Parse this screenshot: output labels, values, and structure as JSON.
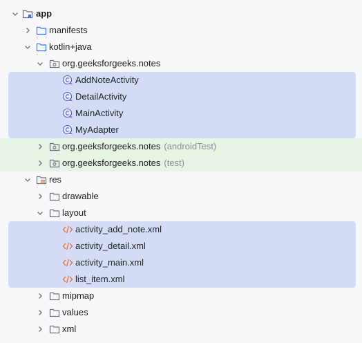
{
  "tree": {
    "app": "app",
    "manifests": "manifests",
    "kotlin_java": "kotlin+java",
    "package_main": "org.geeksforgeeks.notes",
    "classes": [
      "AddNoteActivity",
      "DetailActivity",
      "MainActivity",
      "MyAdapter"
    ],
    "package_android_test": "org.geeksforgeeks.notes",
    "android_test_suffix": "(androidTest)",
    "package_test": "org.geeksforgeeks.notes",
    "test_suffix": "(test)",
    "res": "res",
    "drawable": "drawable",
    "layout": "layout",
    "layout_files": [
      "activity_add_note.xml",
      "activity_detail.xml",
      "activity_main.xml",
      "list_item.xml"
    ],
    "mipmap": "mipmap",
    "values": "values",
    "xml": "xml"
  },
  "colors": {
    "selection": "#d5ddf6",
    "test_highlight": "#e6f3e6",
    "xml_icon": "#e46a2c",
    "class_icon": "#4a63c8",
    "muted_text": "#8c8f96"
  }
}
